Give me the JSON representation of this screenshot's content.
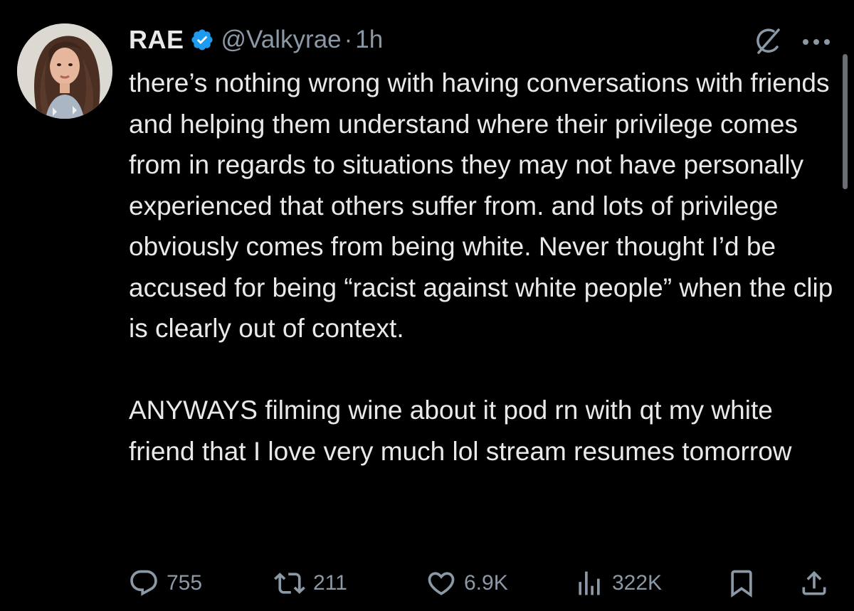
{
  "tweet": {
    "author": {
      "display_name": "RAE",
      "handle": "@Valkyrae",
      "separator": "·",
      "time": "1h",
      "verified": true,
      "verified_color": "#1d9bf0"
    },
    "paragraphs": [
      "there’s nothing wrong with having conversations with friends and helping them understand where their privilege comes from in regards to situations they may not have personally experienced that others suffer from. and lots of privilege obviously comes from being white. Never thought I’d be accused for being “racist against white people” when the clip is clearly out of context.",
      "ANYWAYS filming wine about it pod rn with qt my white friend that I love very much lol stream resumes tomorrow"
    ],
    "actions": {
      "replies": "755",
      "reposts": "211",
      "likes": "6.9K",
      "views": "322K"
    },
    "icons": {
      "reply": "reply-icon",
      "repost": "repost-icon",
      "like": "heart-icon",
      "views": "views-chart-icon",
      "bookmark": "bookmark-icon",
      "share": "share-icon",
      "grok": "grok-icon",
      "more": "more-icon"
    }
  },
  "colors": {
    "background": "#000000",
    "text": "#e7e9ea",
    "secondary": "#8b98a5"
  }
}
